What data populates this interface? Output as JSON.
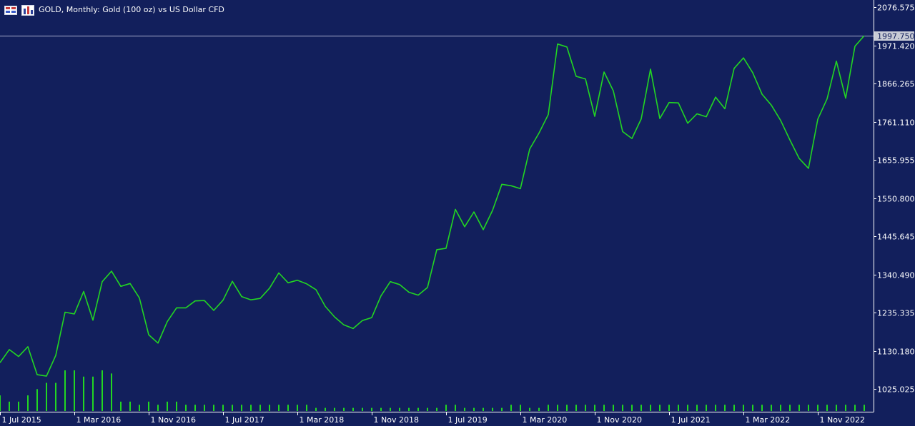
{
  "header": {
    "title": "GOLD, Monthly:  Gold (100 oz) vs US Dollar CFD",
    "icons": [
      "chart-window-icon",
      "chart-type-icon"
    ]
  },
  "colors": {
    "background": "#121f5c",
    "price_line": "#22d622",
    "volume_bars": "#22d622",
    "axis": "#ffffff",
    "current_price_line": "#a9aed0",
    "price_badge_bg": "#c9ccd6",
    "price_badge_text": "#121f5c"
  },
  "chart_data": {
    "type": "line",
    "title": "GOLD, Monthly:  Gold (100 oz) vs US Dollar CFD",
    "x": [
      "2015-07",
      "2015-08",
      "2015-09",
      "2015-10",
      "2015-11",
      "2015-12",
      "2016-01",
      "2016-02",
      "2016-03",
      "2016-04",
      "2016-05",
      "2016-06",
      "2016-07",
      "2016-08",
      "2016-09",
      "2016-10",
      "2016-11",
      "2016-12",
      "2017-01",
      "2017-02",
      "2017-03",
      "2017-04",
      "2017-05",
      "2017-06",
      "2017-07",
      "2017-08",
      "2017-09",
      "2017-10",
      "2017-11",
      "2017-12",
      "2018-01",
      "2018-02",
      "2018-03",
      "2018-04",
      "2018-05",
      "2018-06",
      "2018-07",
      "2018-08",
      "2018-09",
      "2018-10",
      "2018-11",
      "2018-12",
      "2019-01",
      "2019-02",
      "2019-03",
      "2019-04",
      "2019-05",
      "2019-06",
      "2019-07",
      "2019-08",
      "2019-09",
      "2019-10",
      "2019-11",
      "2019-12",
      "2020-01",
      "2020-02",
      "2020-03",
      "2020-04",
      "2020-05",
      "2020-06",
      "2020-07",
      "2020-08",
      "2020-09",
      "2020-10",
      "2020-11",
      "2020-12",
      "2021-01",
      "2021-02",
      "2021-03",
      "2021-04",
      "2021-05",
      "2021-06",
      "2021-07",
      "2021-08",
      "2021-09",
      "2021-10",
      "2021-11",
      "2021-12",
      "2022-01",
      "2022-02",
      "2022-03",
      "2022-04",
      "2022-05",
      "2022-06",
      "2022-07",
      "2022-08",
      "2022-09",
      "2022-10",
      "2022-11",
      "2022-12",
      "2023-01",
      "2023-02",
      "2023-03",
      "2023-04"
    ],
    "series": [
      {
        "values": [
          1098,
          1134,
          1115,
          1142,
          1065,
          1061,
          1118,
          1237,
          1232,
          1294,
          1215,
          1321,
          1350,
          1308,
          1316,
          1276,
          1175,
          1152,
          1211,
          1249,
          1249,
          1268,
          1269,
          1242,
          1270,
          1322,
          1280,
          1271,
          1275,
          1303,
          1345,
          1318,
          1325,
          1315,
          1299,
          1253,
          1224,
          1202,
          1192,
          1214,
          1222,
          1282,
          1321,
          1313,
          1292,
          1284,
          1305,
          1409,
          1413,
          1520,
          1472,
          1513,
          1464,
          1517,
          1589,
          1585,
          1577,
          1686,
          1730,
          1781,
          1975,
          1967,
          1886,
          1879,
          1776,
          1898,
          1846,
          1734,
          1715,
          1769,
          1906,
          1770,
          1814,
          1813,
          1757,
          1783,
          1775,
          1829,
          1797,
          1908,
          1937,
          1896,
          1837,
          1807,
          1765,
          1711,
          1660,
          1633,
          1768,
          1824,
          1928,
          1826,
          1969,
          1998
        ]
      },
      {
        "name": "Volume",
        "values": [
          5,
          3,
          3,
          5,
          7,
          9,
          9,
          13,
          13,
          11,
          11,
          13,
          12,
          3,
          3,
          2,
          3,
          2,
          3,
          3,
          2,
          2,
          2,
          2,
          2,
          2,
          2,
          2,
          2,
          2,
          2,
          2,
          2,
          2,
          1,
          1,
          1,
          1,
          1,
          1,
          1,
          1,
          1,
          1,
          1,
          1,
          1,
          1,
          2,
          2,
          1,
          1,
          1,
          1,
          1,
          2,
          2,
          1,
          1,
          2,
          2,
          2,
          2,
          2,
          2,
          2,
          2,
          2,
          2,
          2,
          2,
          2,
          2,
          2,
          2,
          2,
          2,
          2,
          2,
          2,
          2,
          2,
          2,
          2,
          2,
          2,
          2,
          2,
          2,
          2,
          2,
          2,
          2,
          2
        ]
      }
    ],
    "ylim": [
      965,
      2076.575
    ],
    "y_ticks": [
      "2076.575",
      "1971.420",
      "1866.265",
      "1761.110",
      "1655.955",
      "1550.800",
      "1445.645",
      "1340.490",
      "1235.335",
      "1130.180",
      "1025.025"
    ],
    "y_tick_values": [
      2076.575,
      1971.42,
      1866.265,
      1761.11,
      1655.955,
      1550.8,
      1445.645,
      1340.49,
      1235.335,
      1130.18,
      1025.025
    ],
    "x_ticks": [
      "1 Jul 2015",
      "1 Mar 2016",
      "1 Nov 2016",
      "1 Jul 2017",
      "1 Mar 2018",
      "1 Nov 2018",
      "1 Jul 2019",
      "1 Mar 2020",
      "1 Nov 2020",
      "1 Jul 2021",
      "1 Mar 2022",
      "1 Nov 2022"
    ],
    "x_tick_index": [
      0,
      8,
      16,
      24,
      32,
      40,
      48,
      56,
      64,
      72,
      80,
      88
    ],
    "current_price": 1997.75,
    "current_price_label": "1997.750",
    "grid": false,
    "legend": "none"
  }
}
